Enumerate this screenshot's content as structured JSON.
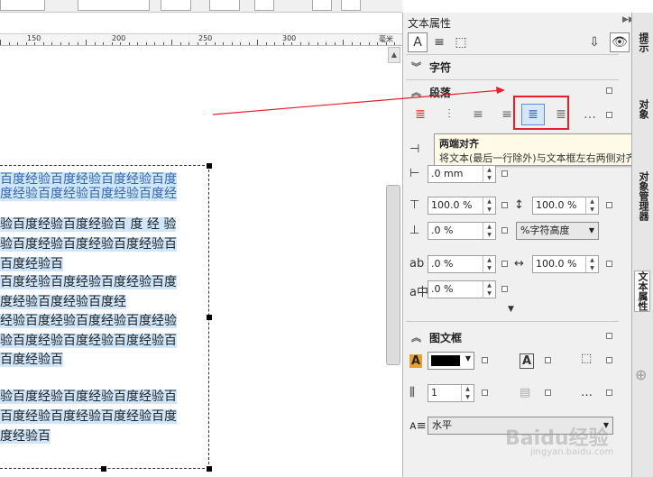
{
  "ruler": {
    "labels": [
      "150",
      "200",
      "250",
      "300"
    ],
    "unit": "毫米"
  },
  "canvas": {
    "text_lines": [
      "百度经验百度经验百度经验百度",
      "度经验百度经验百度经验百度经",
      "",
      "验百度经验百度经验百 度 经 验",
      "验百度经验百度经验百度经验百",
      "百度经验百",
      "百度经验百度经验百度经验百度",
      "度经验百度经验百度经",
      "经验百度经验百度经验百度经验",
      "验百度经验百度经验百度经验百",
      "百度经验百",
      "",
      "验百度经验百度经验百度经验百",
      "百度经验百度经验百度经验百度",
      "度经验百"
    ]
  },
  "docker": {
    "title": "文本属性",
    "sections": {
      "character": "字符",
      "paragraph": "段落",
      "frame": "图文框"
    },
    "tooltip": {
      "title": "两端对齐",
      "description": "将文本(最后一行除外)与文本框左右两侧对齐。"
    },
    "paragraph_fields": {
      "indent_value": ".0 mm",
      "line_before": "100.0 %",
      "line_spacing": "100.0 %",
      "space_after": ".0 %",
      "spacing_unit": "%字符高度",
      "char_spacing": ".0 %",
      "word_spacing": "100.0 %",
      "lang_spacing": ".0 %"
    },
    "frame_fields": {
      "columns": "1",
      "direction": "水平"
    },
    "colors": {
      "fill_swatch": "#000000",
      "highlight": "#cfe6fb",
      "selected_btn": "#d8e7f8",
      "annotation_red": "#e8202a"
    }
  },
  "vtabs": {
    "hints": "提示",
    "object": "对象",
    "object_manager": "对象管理器",
    "text_props": "文本属性"
  },
  "watermark": {
    "logo": "Baidu经验",
    "sub": "jingyan.baidu.com"
  }
}
